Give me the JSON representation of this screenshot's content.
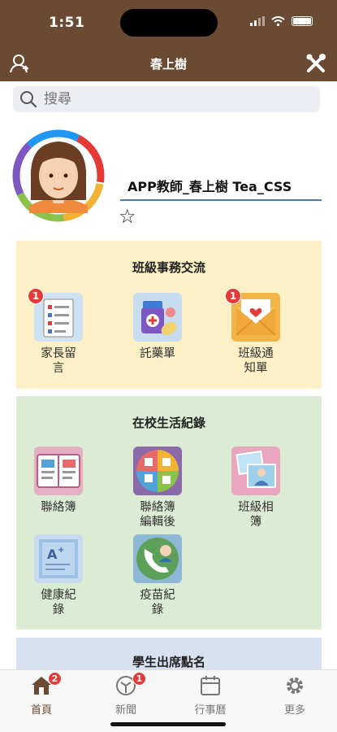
{
  "status": {
    "time": "1:51"
  },
  "nav": {
    "title": "春上樹",
    "left_icon": "user-switch-icon",
    "right_icon": "tools-icon"
  },
  "search": {
    "placeholder": "搜尋"
  },
  "profile": {
    "name": "APP教師_春上樹 Tea_CSS",
    "favorite_icon": "star-outline-icon",
    "ring_colors": [
      "#f2b233",
      "#8bc34a",
      "#7e57c2",
      "#2196f3",
      "#e53935"
    ]
  },
  "sections": {
    "class_affairs": {
      "title": "班級事務交流",
      "items": [
        {
          "label": "家長留\n言",
          "badge": "1",
          "icon": "parent-message-icon"
        },
        {
          "label": "託藥單",
          "badge": "",
          "icon": "medicine-icon"
        },
        {
          "label": "班級通\n知單",
          "badge": "1",
          "icon": "notice-letter-icon"
        }
      ]
    },
    "school_life": {
      "title": "在校生活紀錄",
      "items": [
        {
          "label": "聯絡簿",
          "icon": "contact-book-icon"
        },
        {
          "label": "聯絡簿\n編輯後",
          "icon": "contact-book-edited-icon"
        },
        {
          "label": "班級相\n簿",
          "icon": "photo-album-icon"
        },
        {
          "label": "健康紀\n錄",
          "icon": "health-record-icon"
        },
        {
          "label": "疫苗紀\n錄",
          "icon": "vaccine-record-icon"
        }
      ]
    },
    "attendance": {
      "title": "學生出席點名"
    }
  },
  "tabs": [
    {
      "label": "首頁",
      "badge": "2",
      "icon": "home-icon",
      "active": true
    },
    {
      "label": "新聞",
      "badge": "1",
      "icon": "news-icon",
      "active": false
    },
    {
      "label": "行事曆",
      "badge": "",
      "icon": "calendar-icon",
      "active": false
    },
    {
      "label": "更多",
      "badge": "",
      "icon": "gear-icon",
      "active": false
    }
  ],
  "colors": {
    "brand": "#6b4a33",
    "badge": "#e33a3a",
    "card_yellow": "#fdf0c6",
    "card_green": "#dcebd3",
    "card_blue": "#d8e1ef"
  }
}
